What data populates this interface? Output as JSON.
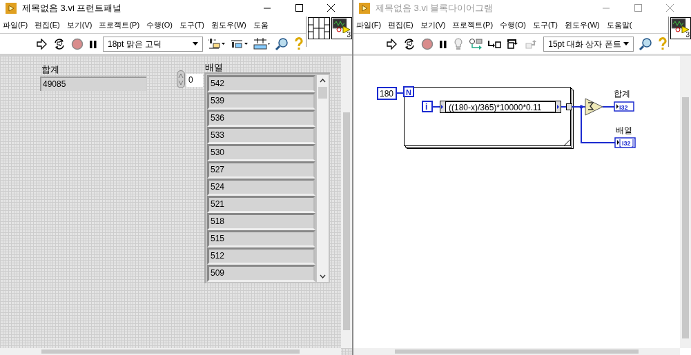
{
  "front_panel": {
    "title": "제목없음 3.vi 프런트패널",
    "active": true,
    "menu": [
      "파일(F)",
      "편집(E)",
      "보기(V)",
      "프로젝트(P)",
      "수행(O)",
      "도구(T)",
      "윈도우(W)",
      "도움"
    ],
    "toolbar": {
      "font": "18pt 맑은 고딕"
    },
    "icon_number": "3",
    "sum": {
      "label": "합계",
      "value": "49085"
    },
    "array": {
      "label": "배열",
      "index": "0",
      "values": [
        "542",
        "539",
        "536",
        "533",
        "530",
        "527",
        "524",
        "521",
        "518",
        "515",
        "512",
        "509"
      ]
    }
  },
  "block_diagram": {
    "title": "제목없음 3.vi 블록다이어그램",
    "active": false,
    "menu": [
      "파일(F)",
      "편집(E)",
      "보기(V)",
      "프로젝트(P)",
      "수행(O)",
      "도구(T)",
      "윈도우(W)",
      "도움말("
    ],
    "toolbar": {
      "font": "15pt 대화 상자 폰트"
    },
    "icon_number": "3",
    "constant": "180",
    "count_terminal": "N",
    "iteration_terminal": "i",
    "formula": "((180-x)/365)*10000*0.11",
    "sum_terminal": {
      "label": "합계",
      "type": "I32"
    },
    "array_terminal": {
      "label": "배열",
      "type": "I32"
    }
  }
}
